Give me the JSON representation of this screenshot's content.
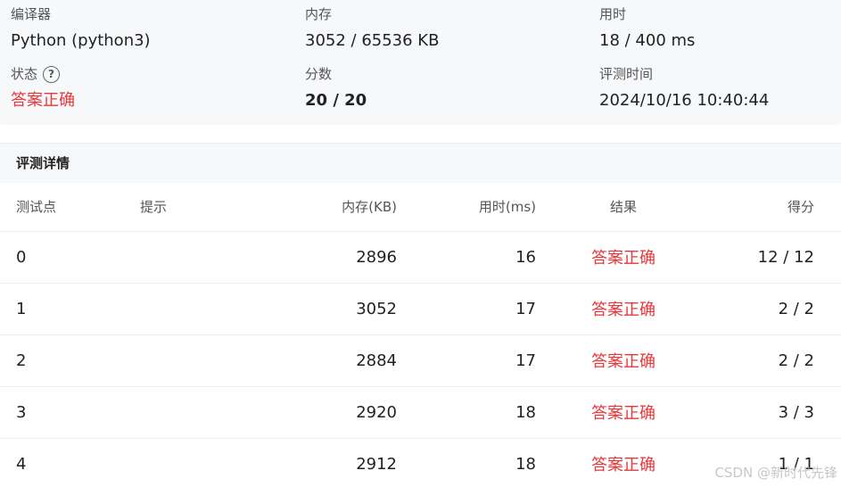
{
  "summary": {
    "compiler_label": "编译器",
    "compiler_value": "Python (python3)",
    "memory_label": "内存",
    "memory_value": "3052 / 65536 KB",
    "time_label": "用时",
    "time_value": "18 / 400 ms",
    "status_label": "状态",
    "status_value": "答案正确",
    "score_label": "分数",
    "score_value": "20 / 20",
    "judge_time_label": "评测时间",
    "judge_time_value": "2024/10/16 10:40:44",
    "status_color": "#e8363a",
    "help_icon": "question-circle-icon"
  },
  "detail": {
    "title": "评测详情",
    "headers": [
      "测试点",
      "提示",
      "内存(KB)",
      "用时(ms)",
      "结果",
      "得分"
    ],
    "rows": [
      {
        "point": "0",
        "hint": "",
        "memory": "2896",
        "time": "16",
        "result": "答案正确",
        "score": "12 / 12"
      },
      {
        "point": "1",
        "hint": "",
        "memory": "3052",
        "time": "17",
        "result": "答案正确",
        "score": "2 / 2"
      },
      {
        "point": "2",
        "hint": "",
        "memory": "2884",
        "time": "17",
        "result": "答案正确",
        "score": "2 / 2"
      },
      {
        "point": "3",
        "hint": "",
        "memory": "2920",
        "time": "18",
        "result": "答案正确",
        "score": "3 / 3"
      },
      {
        "point": "4",
        "hint": "",
        "memory": "2912",
        "time": "18",
        "result": "答案正确",
        "score": "1 / 1"
      }
    ]
  },
  "watermark": "CSDN @新时代先锋"
}
